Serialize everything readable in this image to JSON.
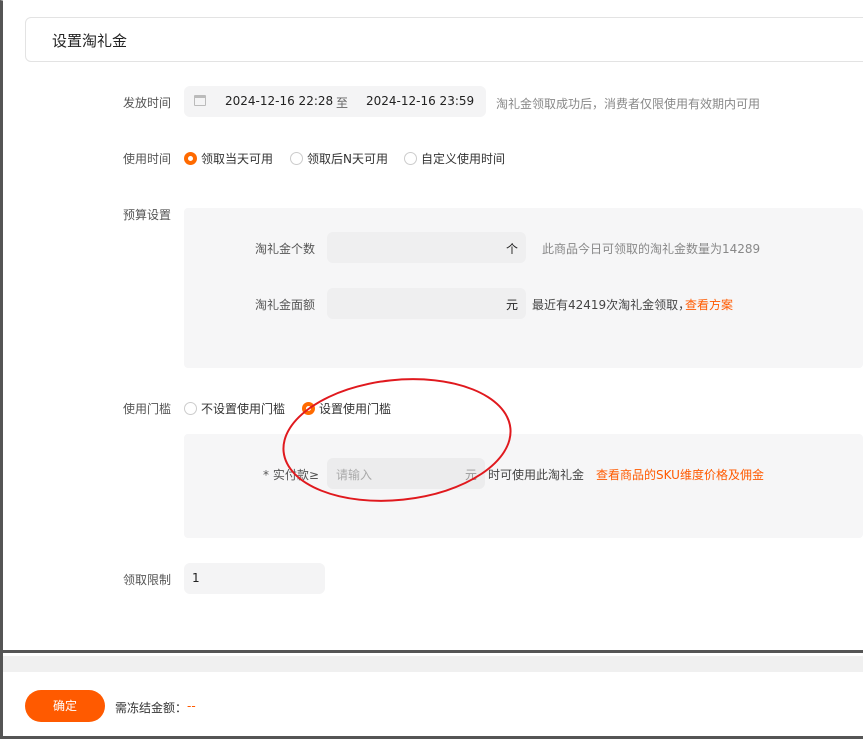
{
  "header": {
    "title": "设置淘礼金"
  },
  "issue_time": {
    "label": "发放时间",
    "start": "2024-12-16 22:28",
    "to": "至",
    "end": "2024-12-16 23:59",
    "hint": "淘礼金领取成功后，消费者仅限使用有效期内可用"
  },
  "use_time": {
    "label": "使用时间",
    "options": [
      "领取当天可用",
      "领取后N天可用",
      "自定义使用时间"
    ],
    "selected_index": 0
  },
  "budget": {
    "label": "预算设置",
    "count_label": "淘礼金个数",
    "count_unit": "个",
    "count_hint": "此商品今日可领取的淘礼金数量为14289",
    "amount_label": "淘礼金面额",
    "amount_unit": "元",
    "amount_hint": "最近有42419次淘礼金领取，",
    "amount_link": "查看方案"
  },
  "threshold": {
    "label": "使用门槛",
    "options": [
      "不设置使用门槛",
      "设置使用门槛"
    ],
    "selected_index": 1,
    "pay_label": "* 实付款≥",
    "pay_placeholder": "请输入",
    "pay_unit": "元",
    "pay_hint": "时可使用此淘礼金",
    "pay_link": "查看商品的SKU维度价格及佣金"
  },
  "limit": {
    "label": "领取限制",
    "value": "1"
  },
  "footer": {
    "confirm": "确定",
    "freeze_label": "需冻结金额：",
    "freeze_value": "--"
  },
  "colors": {
    "accent": "#ff5a00",
    "annotation": "#e0191e"
  }
}
